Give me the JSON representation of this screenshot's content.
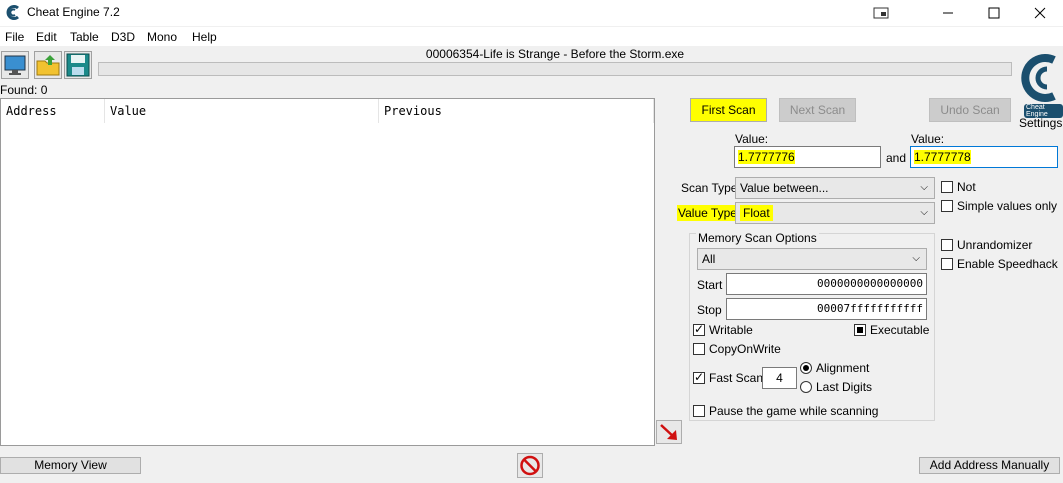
{
  "window": {
    "title": "Cheat Engine 7.2"
  },
  "menu": [
    "File",
    "Edit",
    "Table",
    "D3D",
    "Mono",
    "Help"
  ],
  "process": {
    "name": "00006354-Life is Strange - Before the Storm.exe"
  },
  "found": "Found: 0",
  "columns": [
    "Address",
    "Value",
    "Previous"
  ],
  "buttons": {
    "first_scan": "First Scan",
    "next_scan": "Next Scan",
    "undo_scan": "Undo Scan",
    "settings": "Settings",
    "memory_view": "Memory View",
    "add_address": "Add Address Manually"
  },
  "scan": {
    "value_label_1": "Value:",
    "value_1": "1.7777776",
    "and_label": "and",
    "value_label_2": "Value:",
    "value_2": "1.7777778",
    "scan_type_label": "Scan Type",
    "scan_type": "Value between...",
    "value_type_label": "Value Type",
    "value_type": "Float",
    "not_label": "Not",
    "simple_values_label": "Simple values only"
  },
  "memory": {
    "group_title": "Memory Scan Options",
    "region": "All",
    "start_label": "Start",
    "start": "0000000000000000",
    "stop_label": "Stop",
    "stop": "00007fffffffffff",
    "writable_label": "Writable",
    "executable_label": "Executable",
    "copyonwrite_label": "CopyOnWrite",
    "fastscan_label": "Fast Scan",
    "fastscan_value": "4",
    "alignment_label": "Alignment",
    "lastdigits_label": "Last Digits",
    "pause_label": "Pause the game while scanning"
  },
  "extra": {
    "unrandomizer_label": "Unrandomizer",
    "speedhack_label": "Enable Speedhack"
  },
  "logo_text": "Cheat Engine",
  "colors": {
    "highlight": "#ffff00",
    "accent": "#0078d7"
  }
}
